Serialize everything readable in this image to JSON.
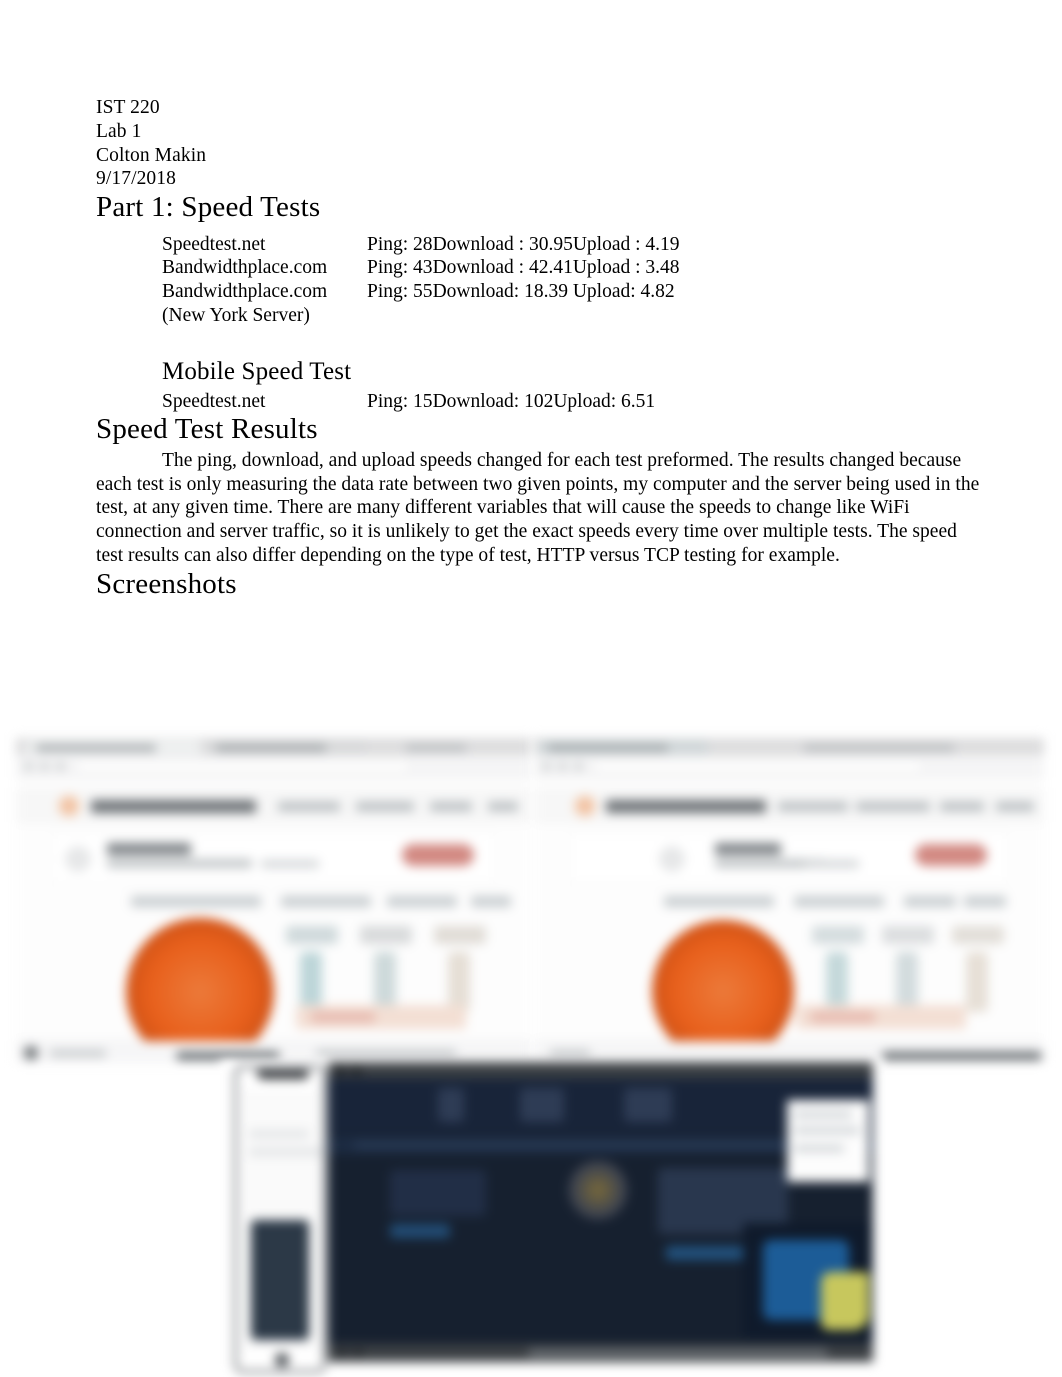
{
  "header": {
    "lines": [
      "IST 220",
      "Lab 1",
      "Colton Makin",
      "9/17/2018"
    ]
  },
  "sections": {
    "part1_title": "Part 1: Speed Tests",
    "mobile_title": "Mobile Speed Test",
    "results_title": "Speed Test Results",
    "screenshots_title": "Screenshots"
  },
  "speed_tests": {
    "rows": [
      {
        "site": "Speedtest.net",
        "ping": "Ping: 28",
        "download": "Download : 30.95",
        "upload": "Upload : 4.19"
      },
      {
        "site": "Bandwidthplace.com",
        "ping": "Ping: 43",
        "download": "Download : 42.41",
        "upload": "Upload : 3.48"
      },
      {
        "site": "Bandwidthplace.com",
        "ping": "Ping:  55",
        "download": "Download:  18.39",
        "upload": "Upload:  4.82"
      }
    ],
    "site_note": "(New York Server)"
  },
  "mobile_test": {
    "rows": [
      {
        "site": "Speedtest.net",
        "ping": "Ping:  15",
        "download": "Download:  102",
        "upload": "Upload:  6.51"
      }
    ]
  },
  "results": {
    "paragraph": "The ping, download, and upload speeds changed for each test preformed. The results changed because each test is only measuring the data rate between two given points, my computer and the server being used in the test, at any given time. There are many different variables that will cause the speeds to change like WiFi connection and server traffic, so it is unlikely to get the exact speeds every time over multiple tests. The speed test results can also differ depending on the type of test, HTTP versus TCP testing for example."
  },
  "screenshots": {
    "items": [
      {
        "name": "bandwidthplace-browser-screenshot-left"
      },
      {
        "name": "bandwidthplace-browser-screenshot-right"
      },
      {
        "name": "speedtest-mobile-dark-screenshot"
      }
    ]
  },
  "colors": {
    "gauge_orange": "#E8601C",
    "cta_red": "#D28982",
    "dark_navy": "#16202F",
    "map_blue": "#1C5C97",
    "map_yellow": "#C7C75D"
  }
}
